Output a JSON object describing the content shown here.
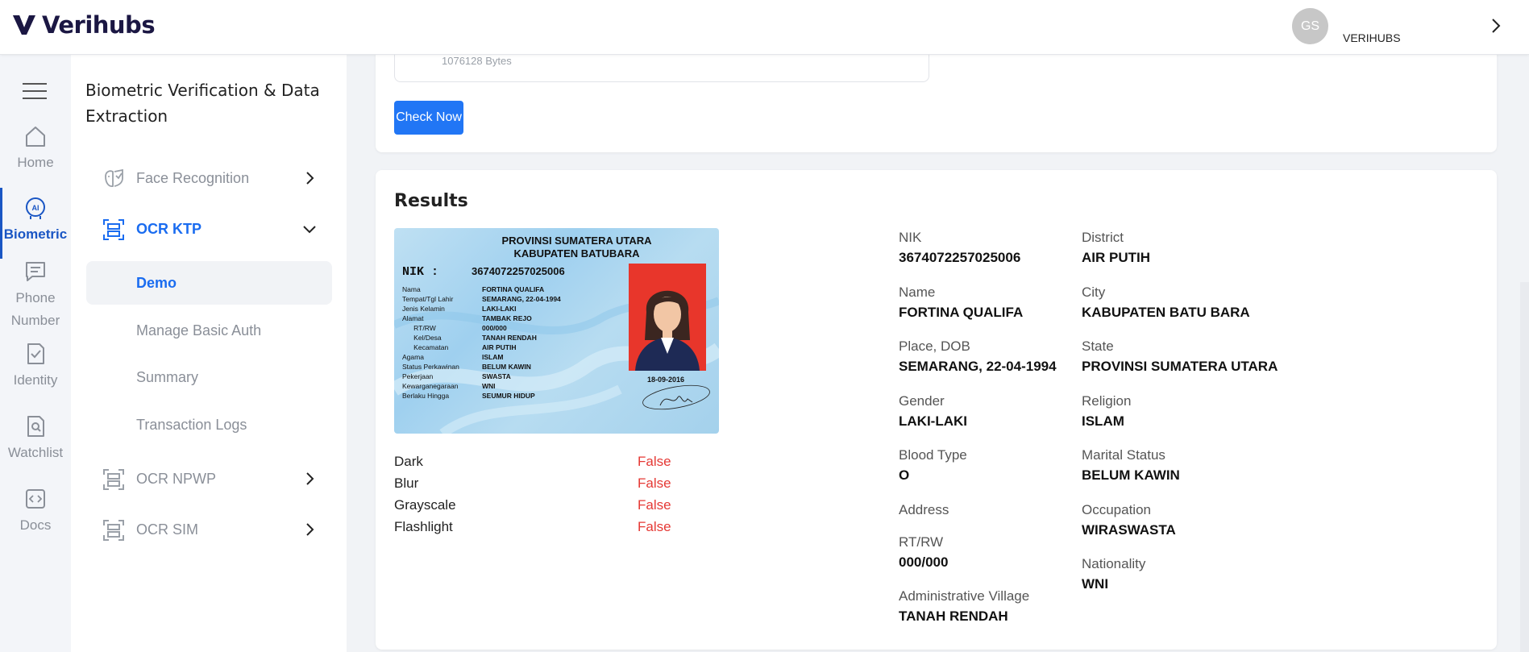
{
  "brand": {
    "name": "Verihubs"
  },
  "header": {
    "avatar_initials": "GS",
    "user_name": "VERIHUBS"
  },
  "rail": {
    "items": [
      {
        "label": "Home",
        "icon": "home-icon"
      },
      {
        "label": "Biometric",
        "icon": "ai-brain-icon",
        "active": true
      },
      {
        "label": "Phone\nNumber",
        "icon": "chat-icon"
      },
      {
        "label": "Identity",
        "icon": "id-check-icon"
      },
      {
        "label": "Watchlist",
        "icon": "search-document-icon"
      },
      {
        "label": "Docs",
        "icon": "code-icon"
      }
    ]
  },
  "subnav": {
    "title": "Biometric Verification & Data Extraction",
    "items": [
      {
        "label": "Face Recognition",
        "icon": "face-scan-icon"
      },
      {
        "label": "OCR KTP",
        "icon": "scan-icon",
        "open": true
      },
      {
        "label": "OCR NPWP",
        "icon": "scan-icon"
      },
      {
        "label": "OCR SIM",
        "icon": "scan-icon"
      }
    ],
    "ocr_ktp_children": [
      "Demo",
      "Manage Basic Auth",
      "Summary",
      "Transaction Logs"
    ],
    "active_child": "Demo"
  },
  "upload": {
    "file_size": "1076128 Bytes",
    "check_button": "Check Now"
  },
  "results": {
    "title": "Results",
    "ktp_card": {
      "province": "PROVINSI SUMATERA UTARA",
      "regency": "KABUPATEN BATUBARA",
      "nik_label": "NIK   :",
      "nik": "3674072257025006",
      "rows": [
        {
          "k": "Nama",
          "v": "FORTINA QUALIFA"
        },
        {
          "k": "Tempat/Tgl Lahir",
          "v": "SEMARANG, 22-04-1994"
        },
        {
          "k": "Jenis Kelamin",
          "v": "LAKI-LAKI"
        },
        {
          "k": "Alamat",
          "v": "TAMBAK REJO"
        },
        {
          "k": "      RT/RW",
          "v": "000/000"
        },
        {
          "k": "      Kel/Desa",
          "v": "TANAH RENDAH"
        },
        {
          "k": "      Kecamatan",
          "v": "AIR PUTIH"
        },
        {
          "k": "Agama",
          "v": "ISLAM"
        },
        {
          "k": "Status Perkawinan",
          "v": "BELUM KAWIN"
        },
        {
          "k": "Pekerjaan",
          "v": "SWASTA"
        },
        {
          "k": "Kewarganegaraan",
          "v": "WNI"
        },
        {
          "k": "Berlaku Hingga",
          "v": "SEUMUR HIDUP"
        }
      ],
      "issue_date": "18-09-2016"
    },
    "quality": [
      {
        "label": "Dark",
        "value": "False"
      },
      {
        "label": "Blur",
        "value": "False"
      },
      {
        "label": "Grayscale",
        "value": "False"
      },
      {
        "label": "Flashlight",
        "value": "False"
      }
    ],
    "fields_left": [
      {
        "label": "NIK",
        "value": "3674072257025006"
      },
      {
        "label": "Name",
        "value": "FORTINA QUALIFA"
      },
      {
        "label": "Place, DOB",
        "value": "SEMARANG, 22-04-1994"
      },
      {
        "label": "Gender",
        "value": "LAKI-LAKI"
      },
      {
        "label": "Blood Type",
        "value": "O"
      },
      {
        "label": "Address",
        "value": ""
      },
      {
        "label": "RT/RW",
        "value": "000/000"
      },
      {
        "label": "Administrative Village",
        "value": "TANAH RENDAH"
      }
    ],
    "fields_right": [
      {
        "label": "District",
        "value": "AIR PUTIH"
      },
      {
        "label": "City",
        "value": "KABUPATEN BATU BARA"
      },
      {
        "label": "State",
        "value": "PROVINSI SUMATERA UTARA"
      },
      {
        "label": "Religion",
        "value": "ISLAM"
      },
      {
        "label": "Marital Status",
        "value": "BELUM KAWIN"
      },
      {
        "label": "Occupation",
        "value": "WIRASWASTA"
      },
      {
        "label": "Nationality",
        "value": "WNI"
      }
    ]
  },
  "colors": {
    "accent": "#1a6cf0",
    "button": "#2176f5",
    "false_value": "#e53935",
    "brand_dark": "#1b1743"
  }
}
